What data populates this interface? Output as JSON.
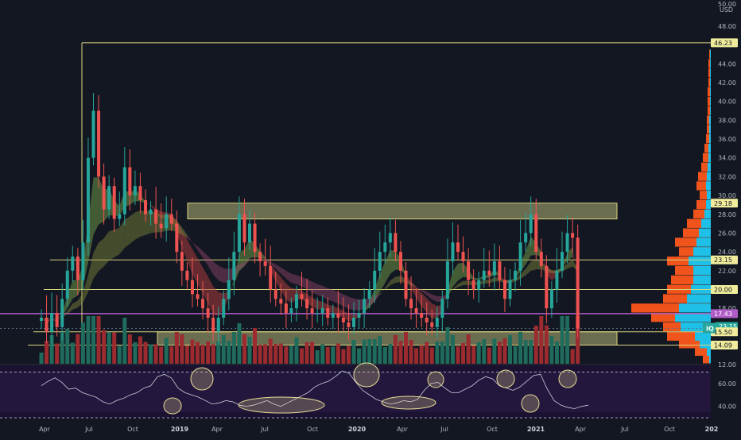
{
  "chart_data": {
    "type": "candlestick",
    "title": "",
    "currency_label": "USD",
    "top_clipped_label": "50.00",
    "price_ticks": [
      12,
      14,
      16,
      18,
      20,
      22,
      24,
      26,
      28,
      30,
      32,
      34,
      36,
      38,
      40,
      42,
      44,
      46,
      48
    ],
    "price_tick_labels": [
      "12.00",
      "14.00",
      "16.00",
      "18.00",
      "20.00",
      "22.00",
      "24.00",
      "26.00",
      "28.00",
      "30.00",
      "32.00",
      "34.00",
      "36.00",
      "38.00",
      "40.00",
      "42.00",
      "44.00",
      "46.00",
      "48.00"
    ],
    "ylim": [
      11.2,
      50.4
    ],
    "time_labels": [
      "Apr",
      "Jul",
      "Oct",
      "2019",
      "Apr",
      "Jul",
      "Oct",
      "2020",
      "Apr",
      "Jul",
      "Oct",
      "2021",
      "Apr",
      "Jul",
      "Oct",
      "202"
    ],
    "price_markers": [
      {
        "label": "46.23",
        "value": 46.23,
        "style": "level"
      },
      {
        "label": "29.18",
        "value": 29.18,
        "style": "level"
      },
      {
        "label": "23.15",
        "value": 23.15,
        "style": "level"
      },
      {
        "label": "20.00",
        "value": 20.0,
        "style": "level"
      },
      {
        "label": "17.43",
        "value": 17.43,
        "style": "pink"
      },
      {
        "label": "15.86",
        "value": 15.86,
        "style": "last"
      },
      {
        "label": "23:15",
        "value": 15.2,
        "style": "countdown"
      },
      {
        "label": "15.50",
        "value": 15.5,
        "style": "level"
      },
      {
        "label": "14.09",
        "value": 14.09,
        "style": "level"
      }
    ],
    "symbol_badge": "IQ",
    "horizontal_levels": [
      46.23,
      23.15,
      20.0,
      17.43,
      15.86,
      15.5,
      14.09
    ],
    "zones": [
      {
        "low": 27.5,
        "high": 29.18
      },
      {
        "low": 14.09,
        "high": 15.5
      }
    ],
    "close": [
      17,
      15.5,
      17.5,
      16,
      19,
      22,
      23.5,
      21,
      25,
      34,
      39,
      32,
      28.5,
      31,
      27.5,
      28,
      33,
      30,
      31,
      29.5,
      28,
      28.5,
      27,
      26.5,
      28,
      27,
      24,
      22,
      21,
      19.5,
      19,
      18,
      17,
      15.5,
      17,
      19,
      21,
      24,
      28,
      25,
      27,
      24,
      23,
      22.5,
      20,
      19,
      18.5,
      17.5,
      18,
      19.5,
      19,
      18,
      17.5,
      17.5,
      18,
      17,
      17.5,
      17,
      16.5,
      16,
      17,
      17.5,
      19,
      20,
      22,
      24,
      25,
      26,
      24,
      22,
      19,
      18,
      17.5,
      17,
      16.5,
      16,
      17,
      19,
      23,
      25,
      24,
      23,
      21,
      20,
      21,
      22,
      21.5,
      23,
      21,
      19,
      21,
      22,
      25,
      26,
      28,
      24,
      22.5,
      18,
      20,
      22,
      24,
      26,
      25.5,
      15.86
    ],
    "rsi": {
      "ticks": [
        60,
        40
      ],
      "tick_labels": [
        "60.00",
        "40.00"
      ],
      "ylim": [
        31.4,
        73.1
      ],
      "overbought": 70,
      "oversold": 30
    },
    "rsi_values": [
      58,
      62,
      65,
      61,
      55,
      56,
      52,
      50,
      48,
      44,
      42,
      45,
      47,
      50,
      52,
      56,
      58,
      66,
      68,
      65,
      56,
      52,
      50,
      48,
      45,
      42,
      43,
      45,
      44,
      41,
      40,
      41,
      43,
      45,
      42,
      40,
      43,
      46,
      49,
      52,
      57,
      60,
      62,
      66,
      71,
      69,
      61,
      54,
      50,
      46,
      44,
      42,
      43,
      45,
      44,
      46,
      54,
      60,
      61,
      56,
      52,
      52,
      55,
      58,
      63,
      66,
      64,
      58,
      56,
      54,
      57,
      62,
      67,
      68,
      55,
      45,
      41,
      39,
      38,
      40,
      41
    ]
  }
}
